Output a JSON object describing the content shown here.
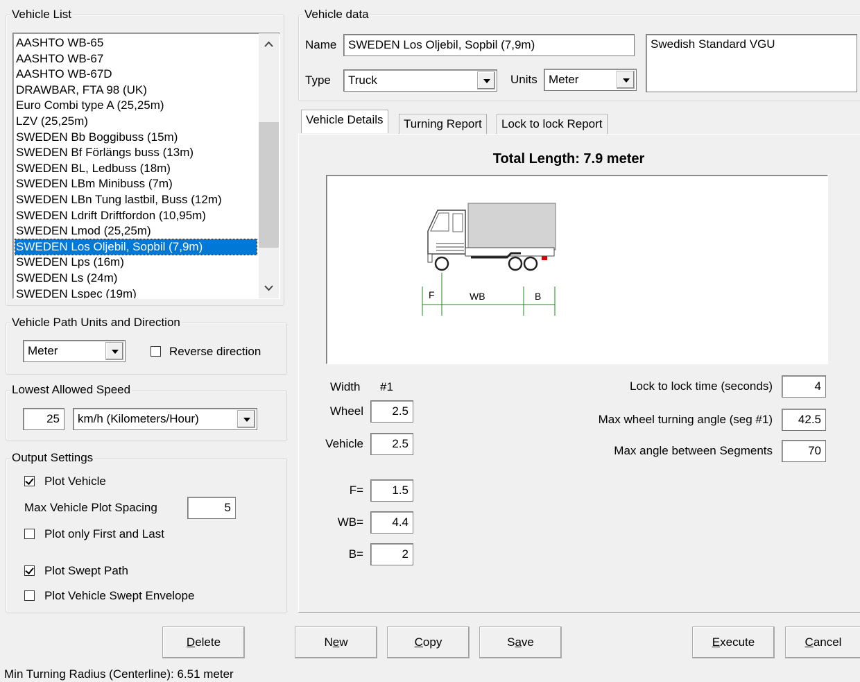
{
  "vehicle_list": {
    "legend": "Vehicle List",
    "items": [
      "AASHTO WB-65",
      "AASHTO WB-67",
      "AASHTO WB-67D",
      "DRAWBAR, FTA 98 (UK)",
      "Euro Combi type A (25,25m)",
      "LZV (25,25m)",
      "SWEDEN Bb Boggibuss  (15m)",
      "SWEDEN Bf Förlängs buss  (13m)",
      "SWEDEN BL, Ledbuss  (18m)",
      "SWEDEN LBm Minibuss  (7m)",
      "SWEDEN LBn Tung lastbil, Buss (12m)",
      "SWEDEN Ldrift Driftfordon (10,95m)",
      "SWEDEN Lmod  (25,25m)",
      "SWEDEN Los Oljebil, Sopbil  (7,9m)",
      "SWEDEN Lps  (16m)",
      "SWEDEN Ls  (24m)",
      "SWEDEN Lspec  (19m)"
    ],
    "selected": "SWEDEN Los Oljebil, Sopbil  (7,9m)",
    "scroll_up_icon": "chevron-up-icon",
    "scroll_down_icon": "chevron-down-icon"
  },
  "path_units": {
    "legend": "Vehicle Path Units and Direction",
    "units_value": "Meter",
    "reverse_label": "Reverse direction",
    "reverse_checked": false
  },
  "speed": {
    "legend": "Lowest Allowed Speed",
    "value": "25",
    "unit_value": "km/h (Kilometers/Hour)"
  },
  "output": {
    "legend": "Output Settings",
    "plot_vehicle_label": "Plot Vehicle",
    "plot_vehicle_checked": true,
    "spacing_label": "Max Vehicle Plot Spacing",
    "spacing_value": "5",
    "first_last_label": "Plot only First and Last",
    "first_last_checked": false,
    "swept_path_label": "Plot Swept Path",
    "swept_path_checked": true,
    "envelope_label": "Plot Vehicle Swept Envelope",
    "envelope_checked": false
  },
  "vehicle_data": {
    "legend": "Vehicle data",
    "name_label": "Name",
    "name_value": "SWEDEN Los Oljebil, Sopbil  (7,9m)",
    "type_label": "Type",
    "type_value": "Truck",
    "units_label": "Units",
    "units_value": "Meter",
    "description": "Swedish Standard VGU"
  },
  "tabs": [
    "Vehicle Details",
    "Turning Report",
    "Lock to lock Report"
  ],
  "details": {
    "total_length": "Total Length: 7.9 meter",
    "diagram": {
      "f": "F",
      "wb": "WB",
      "b": "B"
    },
    "width_label": "Width",
    "width_col": "#1",
    "wheel_label": "Wheel",
    "wheel_value": "2.5",
    "vehicle_label": "Vehicle",
    "vehicle_value": "2.5",
    "f_label": "F=",
    "f_value": "1.5",
    "wb_label": "WB=",
    "wb_value": "4.4",
    "b_label": "B=",
    "b_value": "2",
    "lock_time_label": "Lock to lock time (seconds)",
    "lock_time_value": "4",
    "max_wheel_label": "Max wheel turning angle (seg #1)",
    "max_wheel_value": "42.5",
    "max_angle_label": "Max angle between Segments",
    "max_angle_value": "70"
  },
  "buttons": {
    "delete": {
      "pre": "",
      "u": "D",
      "post": "elete"
    },
    "new": {
      "pre": "N",
      "u": "e",
      "post": "w"
    },
    "copy": {
      "pre": "",
      "u": "C",
      "post": "opy"
    },
    "save": {
      "pre": "S",
      "u": "a",
      "post": "ve"
    },
    "execute": {
      "pre": "",
      "u": "E",
      "post": "xecute"
    },
    "cancel": {
      "pre": "",
      "u": "C",
      "post": "ancel"
    }
  },
  "status": "Min Turning Radius (Centerline): 6.51 meter"
}
